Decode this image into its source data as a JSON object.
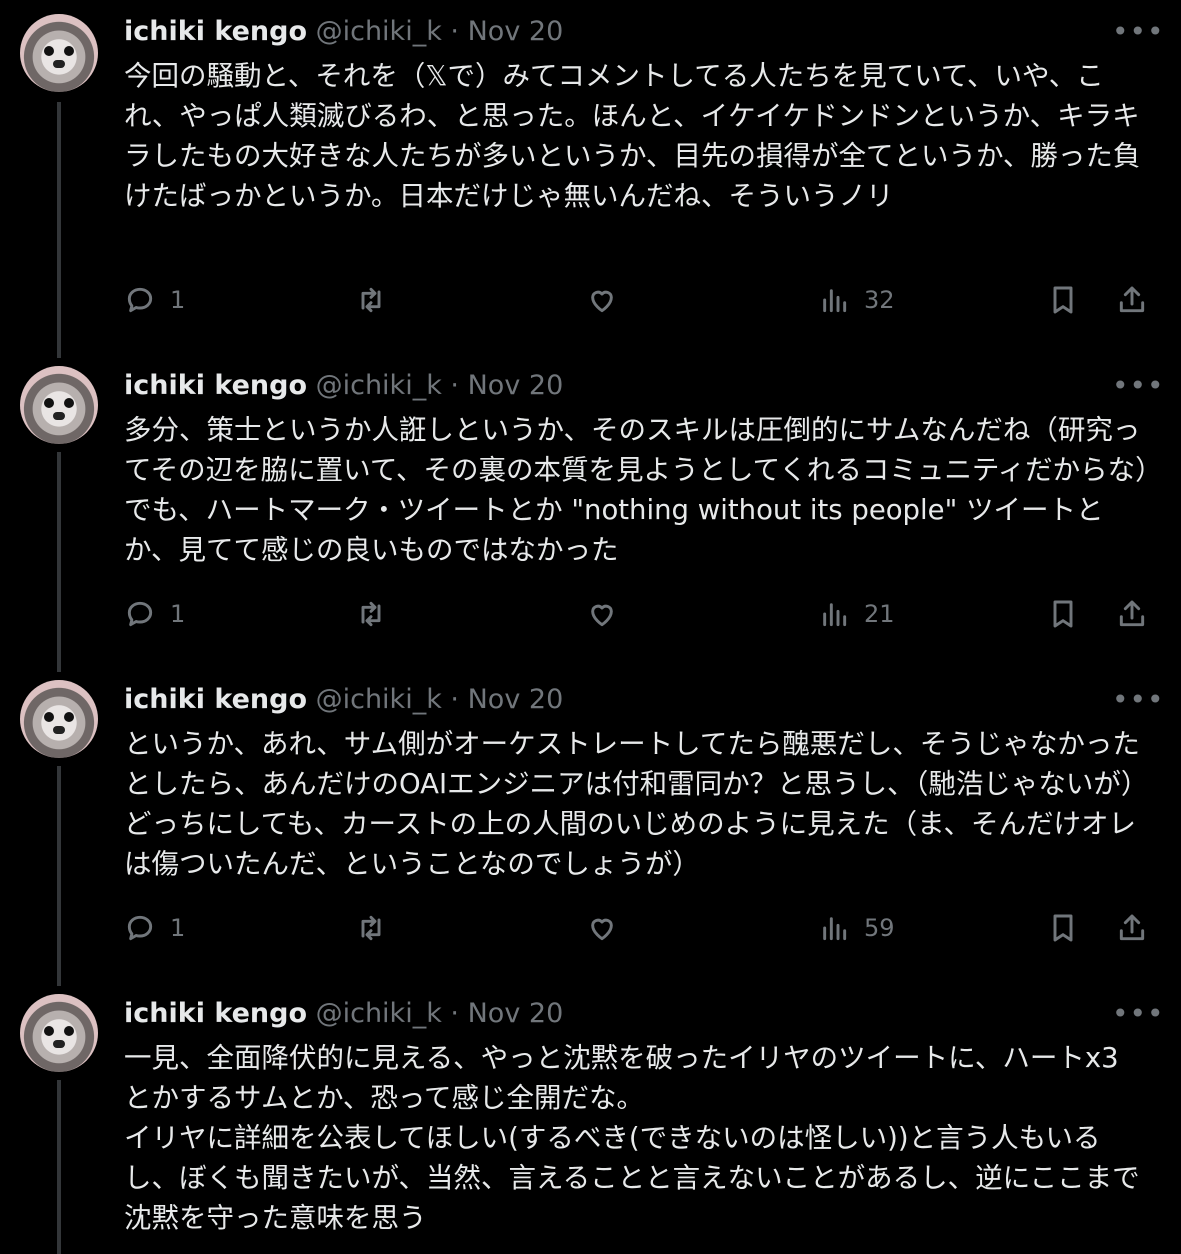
{
  "tweets": [
    {
      "name": "ichiki kengo",
      "handle": "@ichiki_k",
      "separator": "·",
      "date": "Nov 20",
      "text": "今回の騒動と、それを（𝕏で）みてコメントしてる人たちを見ていて、いや、これ、やっぱ人類滅びるわ、と思った。ほんと、イケイケドンドンというか、キラキラしたもの大好きな人たちが多いというか、目先の損得が全てというか、勝った負けたばっかというか。日本だけじゃ無いんだね、そういうノリ",
      "replies": "1",
      "views": "32"
    },
    {
      "name": "ichiki kengo",
      "handle": "@ichiki_k",
      "separator": "·",
      "date": "Nov 20",
      "text": "多分、策士というか人誑しというか、そのスキルは圧倒的にサムなんだね（研究ってその辺を脇に置いて、その裏の本質を見ようとしてくれるコミュニティだからな）でも、ハートマーク・ツイートとか \"nothing without its people\" ツイートとか、見てて感じの良いものではなかった",
      "replies": "1",
      "views": "21"
    },
    {
      "name": "ichiki kengo",
      "handle": "@ichiki_k",
      "separator": "·",
      "date": "Nov 20",
      "text": "というか、あれ、サム側がオーケストレートしてたら醜悪だし、そうじゃなかったとしたら、あんだけのOAIエンジニアは付和雷同か？と思うし、（馳浩じゃないが）どっちにしても、カーストの上の人間のいじめのように見えた（ま、そんだけオレは傷ついたんだ、ということなのでしょうが）",
      "replies": "1",
      "views": "59"
    },
    {
      "name": "ichiki kengo",
      "handle": "@ichiki_k",
      "separator": "·",
      "date": "Nov 20",
      "text": "一見、全面降伏的に見える、やっと沈黙を破ったイリヤのツイートに、ハートx3 とかするサムとか、恐って感じ全開だな。\nイリヤに詳細を公表してほしい(するべき(できないのは怪しい))と言う人もいるし、ぼくも聞きたいが、当然、言えることと言えないことがあるし、逆にここまで沈黙を守った意味を思う"
    }
  ]
}
